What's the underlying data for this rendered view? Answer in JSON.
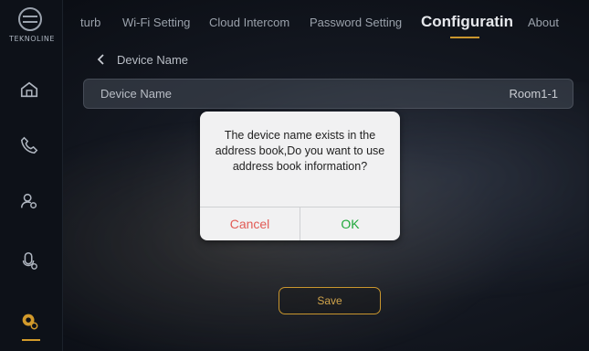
{
  "brand": {
    "logo_text": "TEKNOLINE"
  },
  "sidebar": {
    "items": [
      {
        "icon": "home-icon"
      },
      {
        "icon": "phone-icon"
      },
      {
        "icon": "user-settings-icon"
      },
      {
        "icon": "intercom-icon"
      },
      {
        "icon": "settings-icon",
        "active": true
      }
    ],
    "accent": "#d29a2b"
  },
  "topnav": {
    "tabs": [
      {
        "label": "turb"
      },
      {
        "label": "Wi-Fi Setting"
      },
      {
        "label": "Cloud Intercom"
      },
      {
        "label": "Password Setting"
      },
      {
        "label": "Configuratin",
        "active": true
      },
      {
        "label": "About"
      }
    ]
  },
  "page": {
    "breadcrumb": "Device Name",
    "field": {
      "label": "Device Name",
      "value": "Room1-1"
    },
    "save_label": "Save"
  },
  "dialog": {
    "message": "The device name exists in the address book,Do you want to use address book information?",
    "cancel_label": "Cancel",
    "ok_label": "OK",
    "colors": {
      "cancel": "#e25b55",
      "ok": "#1fa83a"
    }
  }
}
